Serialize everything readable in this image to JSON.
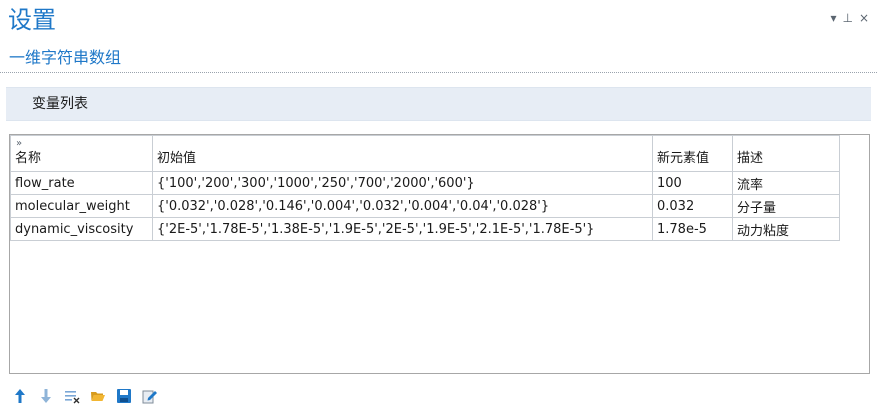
{
  "window": {
    "title": "设置",
    "subtitle": "一维字符串数组",
    "controls": {
      "dropdown": "▾",
      "pin": "⊥",
      "close": "×"
    }
  },
  "section": {
    "title": "变量列表"
  },
  "table": {
    "headers": [
      "名称",
      "初始值",
      "新元素值",
      "描述"
    ],
    "rows": [
      {
        "name": "flow_rate",
        "initial": "{'100','200','300','1000','250','700','2000','600'}",
        "new_value": "100",
        "description": "流率"
      },
      {
        "name": "molecular_weight",
        "initial": "{'0.032','0.028','0.146','0.004','0.032','0.004','0.04','0.028'}",
        "new_value": "0.032",
        "description": "分子量"
      },
      {
        "name": "dynamic_viscosity",
        "initial": "{'2E-5','1.78E-5','1.38E-5','1.9E-5','2E-5','1.9E-5','2.1E-5','1.78E-5'}",
        "new_value": "1.78e-5",
        "description": "动力粘度"
      }
    ]
  },
  "toolbar": {
    "icons": [
      "move-up-icon",
      "move-down-icon",
      "clear-table-icon",
      "open-folder-icon",
      "save-icon",
      "edit-icon"
    ]
  },
  "colors": {
    "accent": "#1f78c8",
    "section_header_bg": "#e7edf5",
    "grid_line": "#c9ced4"
  }
}
